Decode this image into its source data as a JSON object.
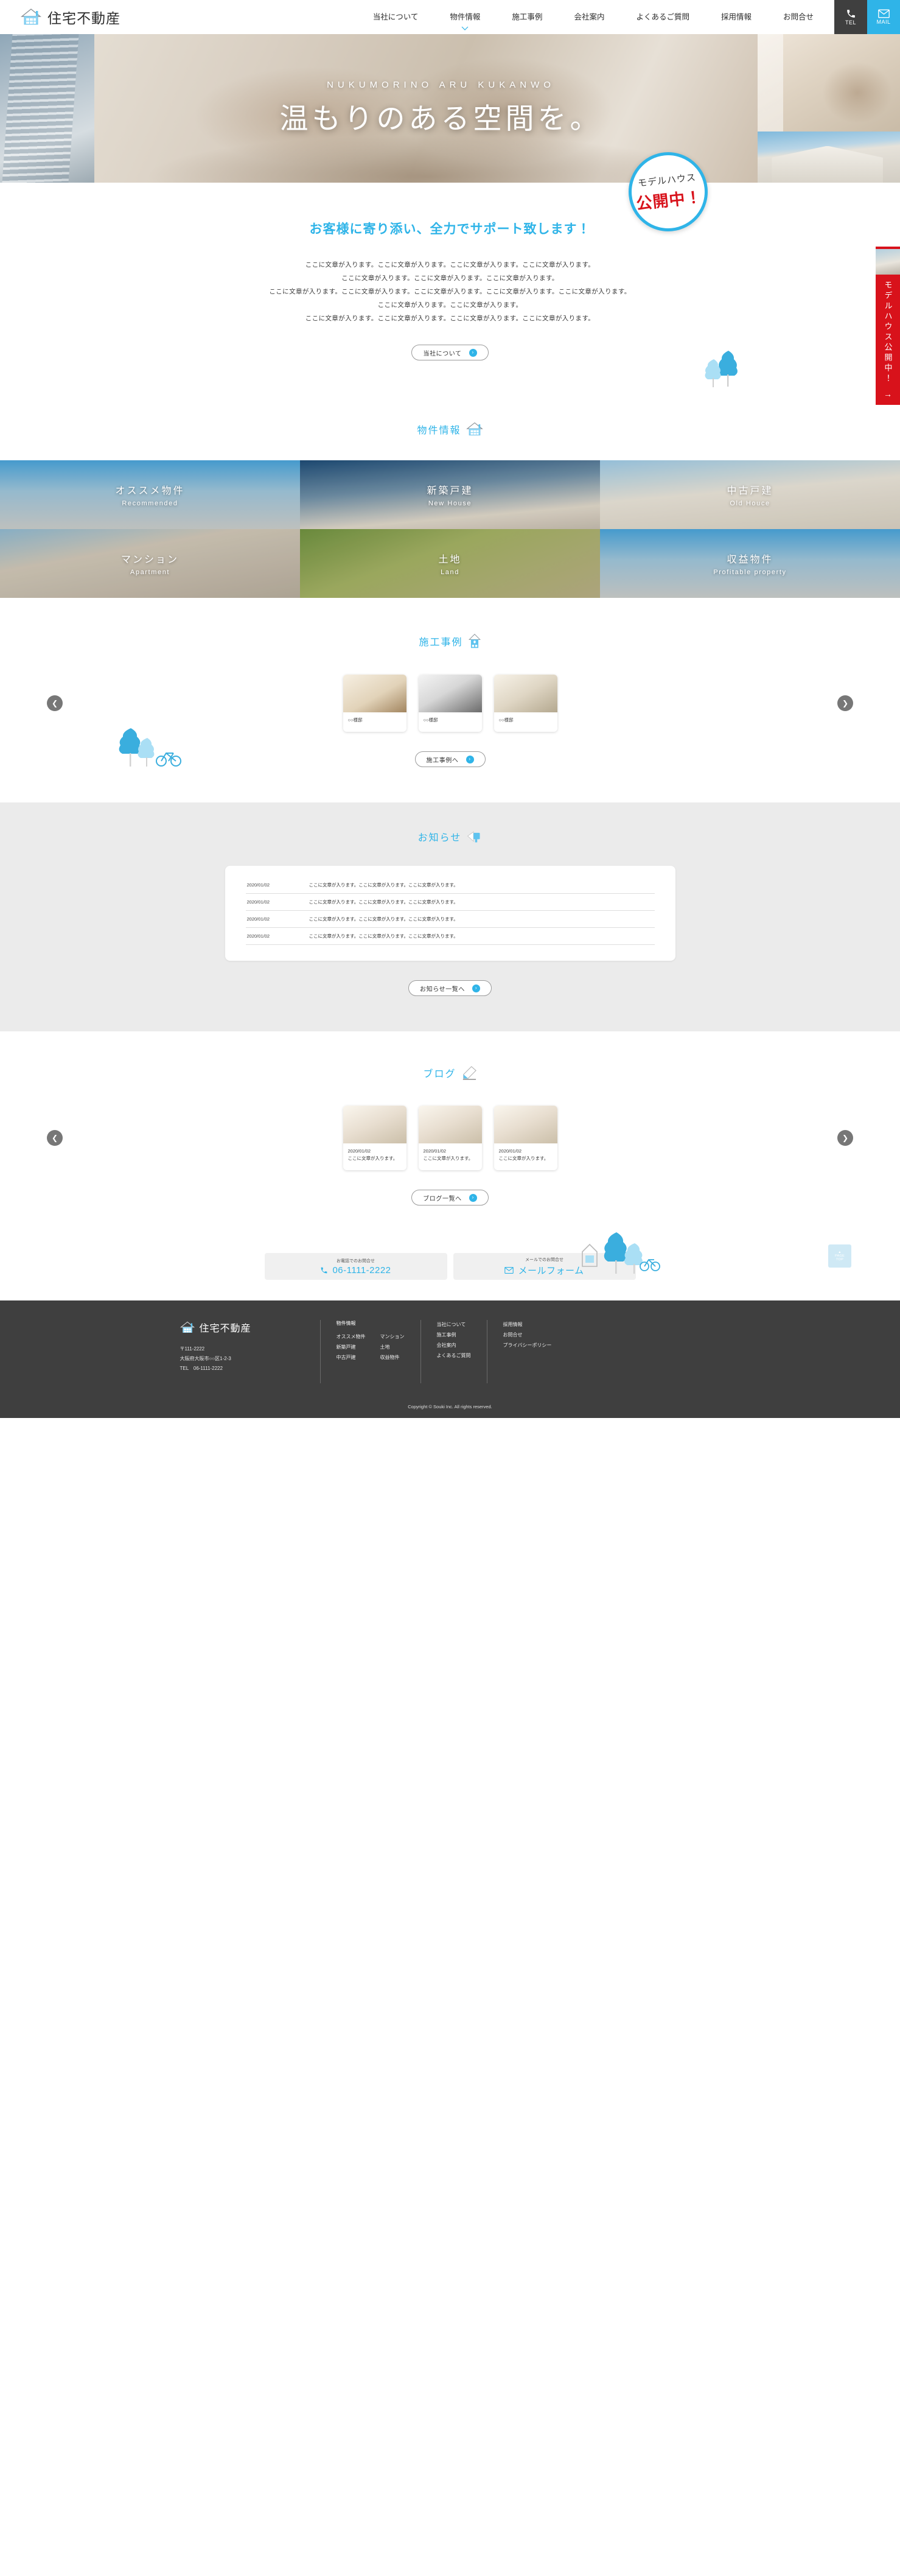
{
  "colors": {
    "accent": "#2fb4e8",
    "dark": "#3f3f3f",
    "red": "#d8121b",
    "news_bg": "#ebebeb"
  },
  "header": {
    "brand": "住宅不動産",
    "logo_icon": "house-icon",
    "nav": [
      {
        "label": "当社について",
        "has_dropdown": false
      },
      {
        "label": "物件情報",
        "has_dropdown": true
      },
      {
        "label": "施工事例",
        "has_dropdown": false
      },
      {
        "label": "会社案内",
        "has_dropdown": false
      },
      {
        "label": "よくあるご質問",
        "has_dropdown": false
      },
      {
        "label": "採用情報",
        "has_dropdown": false
      },
      {
        "label": "お問合せ",
        "has_dropdown": false
      }
    ],
    "tel_button": {
      "label": "TEL",
      "icon": "phone-icon"
    },
    "mail_button": {
      "label": "MAIL",
      "icon": "mail-icon"
    }
  },
  "hero": {
    "subtitle": "NUKUMORINO ARU KUKANWO",
    "title": "温もりのある空間を。",
    "badge": {
      "line1": "モデルハウス",
      "line2": "公開中！"
    },
    "side_banner": {
      "text": "モデルハウス公開中！",
      "arrow": "→"
    }
  },
  "intro": {
    "title": "お客様に寄り添い、全力でサポート致します！",
    "paragraphs": [
      "ここに文章が入ります。ここに文章が入ります。ここに文章が入ります。ここに文章が入ります。",
      "ここに文章が入ります。ここに文章が入ります。ここに文章が入ります。",
      "ここに文章が入ります。ここに文章が入ります。ここに文章が入ります。ここに文章が入ります。ここに文章が入ります。",
      "ここに文章が入ります。ここに文章が入ります。",
      "ここに文章が入ります。ここに文章が入ります。ここに文章が入ります。ここに文章が入ります。"
    ],
    "button": {
      "label": "当社について",
      "arrow": "›"
    }
  },
  "properties": {
    "heading": "物件情報",
    "heading_icon": "house-icon",
    "tiles": [
      {
        "jp": "オススメ物件",
        "en": "Recommended"
      },
      {
        "jp": "新築戸建",
        "en": "New House"
      },
      {
        "jp": "中古戸建",
        "en": "Old Houce"
      },
      {
        "jp": "マンション",
        "en": "Apartment"
      },
      {
        "jp": "土地",
        "en": "Land"
      },
      {
        "jp": "収益物件",
        "en": "Profitable property"
      }
    ]
  },
  "works": {
    "heading": "施工事例",
    "heading_icon": "house-tall-icon",
    "prev_arrow": "❮",
    "next_arrow": "❯",
    "cards": [
      {
        "caption": "○○様邸"
      },
      {
        "caption": "○○様邸"
      },
      {
        "caption": "○○様邸"
      }
    ],
    "button": {
      "label": "施工事例へ",
      "arrow": "›"
    }
  },
  "news": {
    "heading": "お知らせ",
    "heading_icon": "megaphone-icon",
    "rows": [
      {
        "date": "2020/01/02",
        "text": "ここに文章が入ります。ここに文章が入ります。ここに文章が入ります。"
      },
      {
        "date": "2020/01/02",
        "text": "ここに文章が入ります。ここに文章が入ります。ここに文章が入ります。"
      },
      {
        "date": "2020/01/02",
        "text": "ここに文章が入ります。ここに文章が入ります。ここに文章が入ります。"
      },
      {
        "date": "2020/01/02",
        "text": "ここに文章が入ります。ここに文章が入ります。ここに文章が入ります。"
      }
    ],
    "button": {
      "label": "お知らせ一覧へ",
      "arrow": "›"
    }
  },
  "blog": {
    "heading": "ブログ",
    "heading_icon": "pencil-icon",
    "prev_arrow": "❮",
    "next_arrow": "❯",
    "cards": [
      {
        "date": "2020/01/02",
        "text": "ここに文章が入ります。"
      },
      {
        "date": "2020/01/02",
        "text": "ここに文章が入ります。"
      },
      {
        "date": "2020/01/02",
        "text": "ここに文章が入ります。"
      }
    ],
    "button": {
      "label": "ブログ一覧へ",
      "arrow": "›"
    }
  },
  "contact": {
    "tel": {
      "label": "お電話でのお問合せ",
      "value": "06-1111-2222",
      "icon": "phone-icon"
    },
    "mail": {
      "label": "メールでのお問合せ",
      "value": "メールフォーム",
      "icon": "mail-icon"
    },
    "pagetop": {
      "line1": "PAGE",
      "line2": "TOP",
      "arrow": "▲"
    }
  },
  "footer": {
    "brand": "住宅不動産",
    "logo_icon": "house-icon",
    "postal": "〒111-2222",
    "address": "大阪府大阪市○○区1-2-3",
    "tel": "TEL　06-1111-2222",
    "col_properties": {
      "head": "物件情報",
      "left": [
        "オススメ物件",
        "新築戸建",
        "中古戸建"
      ],
      "right": [
        "マンション",
        "土地",
        "収益物件"
      ]
    },
    "col_about": [
      "当社について",
      "施工事例",
      "会社案内",
      "よくあるご質問"
    ],
    "col_misc": [
      "採用情報",
      "お問合せ",
      "プライバシーポリシー"
    ],
    "copyright": "Copyright © Souki Inc. All rights reserved."
  }
}
